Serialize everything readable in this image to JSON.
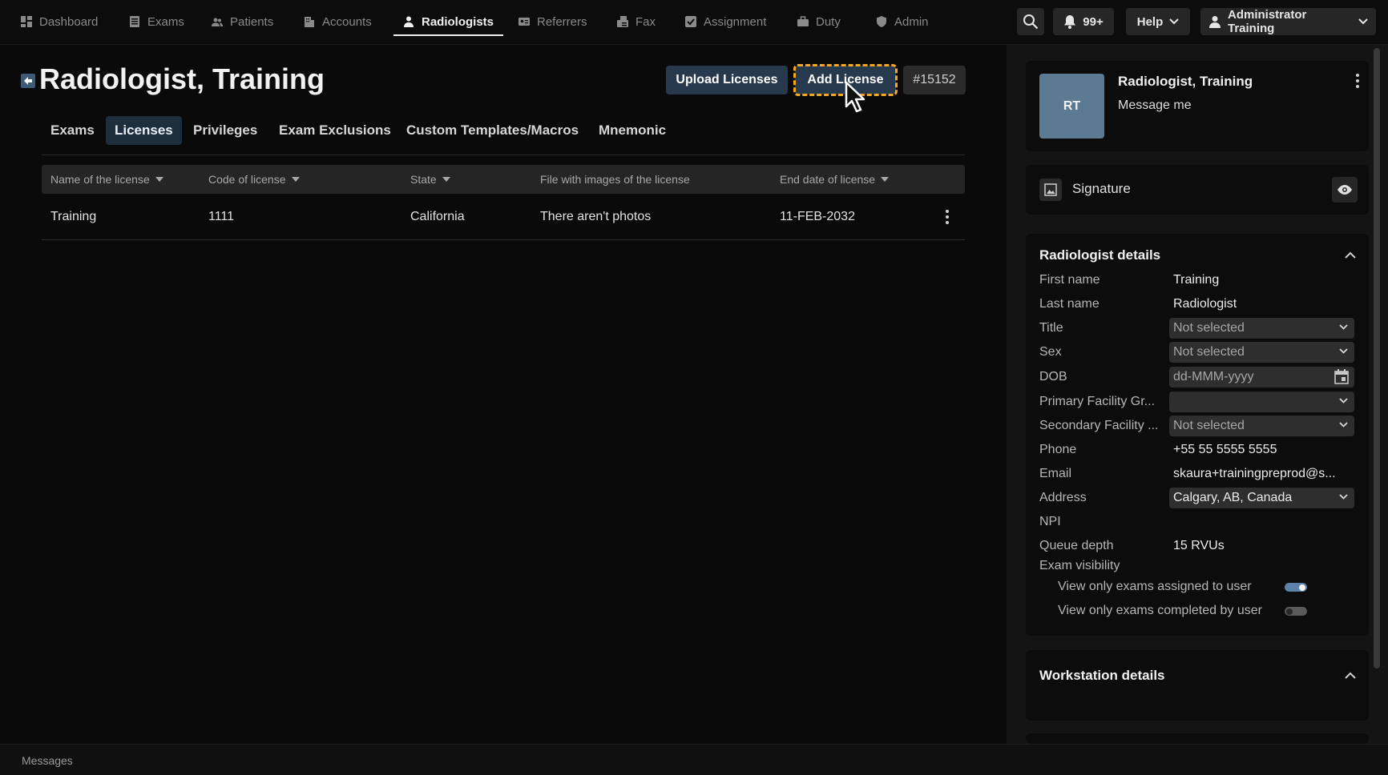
{
  "nav": {
    "items": [
      {
        "label": "Dashboard"
      },
      {
        "label": "Exams"
      },
      {
        "label": "Patients"
      },
      {
        "label": "Accounts"
      },
      {
        "label": "Radiologists",
        "active": true
      },
      {
        "label": "Referrers"
      },
      {
        "label": "Fax"
      },
      {
        "label": "Assignment"
      },
      {
        "label": "Duty"
      },
      {
        "label": "Admin"
      }
    ],
    "notifications_count": "99+",
    "help_label": "Help",
    "user_label": "Administrator Training"
  },
  "page": {
    "title": "Radiologist, Training",
    "upload_label": "Upload Licenses",
    "add_label": "Add License",
    "record_id": "#15152"
  },
  "tabs": [
    {
      "label": "Exams"
    },
    {
      "label": "Licenses",
      "active": true
    },
    {
      "label": "Privileges"
    },
    {
      "label": "Exam Exclusions"
    },
    {
      "label": "Custom Templates/Macros"
    },
    {
      "label": "Mnemonic"
    }
  ],
  "table": {
    "headers": [
      {
        "label": "Name of the license",
        "sortable": true
      },
      {
        "label": "Code of license",
        "sortable": true
      },
      {
        "label": "State",
        "sortable": true
      },
      {
        "label": "File with images of the license",
        "sortable": false
      },
      {
        "label": "End date of license",
        "sortable": true
      }
    ],
    "rows": [
      {
        "name": "Training",
        "code": "1111",
        "state": "California",
        "files": "There aren't photos",
        "end_date": "11-FEB-2032"
      }
    ]
  },
  "profile": {
    "initials": "RT",
    "name": "Radiologist, Training",
    "message": "Message me"
  },
  "signature": {
    "label": "Signature"
  },
  "details": {
    "title": "Radiologist details",
    "first_name_label": "First name",
    "first_name": "Training",
    "last_name_label": "Last name",
    "last_name": "Radiologist",
    "title_label": "Title",
    "title_value": "Not selected",
    "sex_label": "Sex",
    "sex_value": "Not selected",
    "dob_label": "DOB",
    "dob_placeholder": "dd-MMM-yyyy",
    "primary_label": "Primary Facility Gr...",
    "primary_value": "",
    "secondary_label": "Secondary Facility ...",
    "secondary_value": "Not selected",
    "phone_label": "Phone",
    "phone": "+55 55 5555 5555",
    "email_label": "Email",
    "email": "skaura+trainingpreprod@s...",
    "address_label": "Address",
    "address": "Calgary, AB, Canada",
    "npi_label": "NPI",
    "queue_label": "Queue depth",
    "queue": "15 RVUs",
    "visibility_label": "Exam visibility",
    "toggle_assigned_label": "View only exams assigned to user",
    "toggle_assigned": true,
    "toggle_completed_label": "View only exams completed by user",
    "toggle_completed": false
  },
  "workstation": {
    "title": "Workstation details"
  },
  "bottom": {
    "label": "Messages"
  },
  "colors": {
    "accent_button": "#27394d",
    "highlight_outline": "#f5a623",
    "avatar": "#5d7a93"
  }
}
